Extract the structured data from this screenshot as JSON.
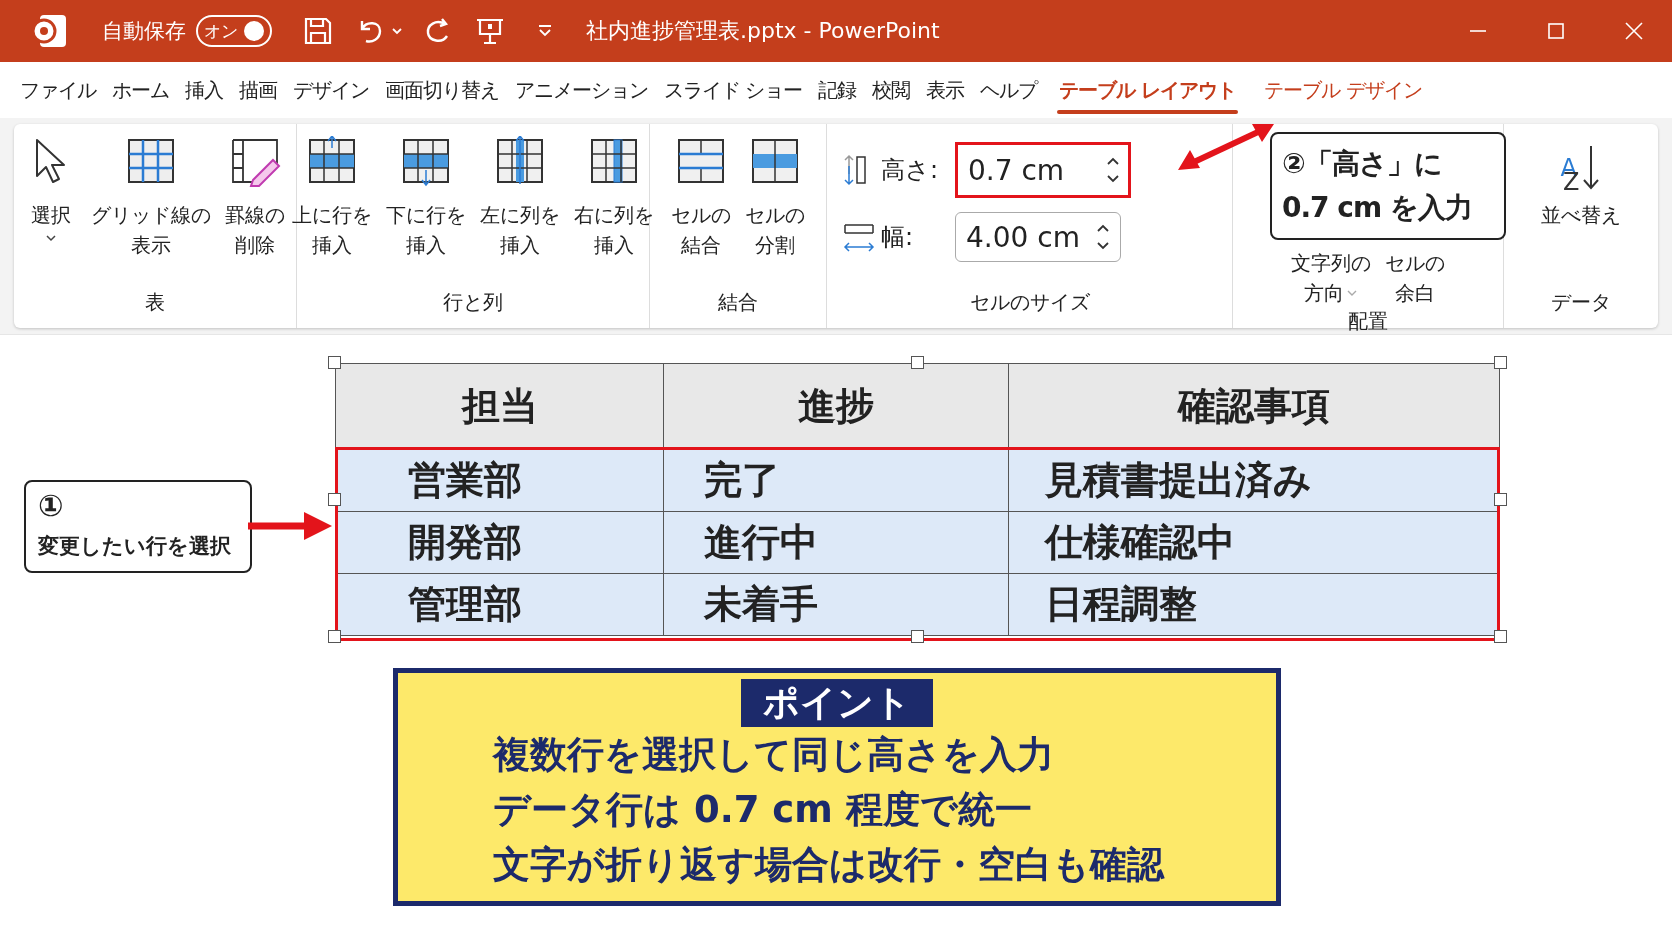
{
  "window": {
    "title": "社内進捗管理表.pptx - PowerPoint"
  },
  "quick_access": {
    "autosave_label": "自動保存",
    "autosave": {
      "label": "オン",
      "on": true
    }
  },
  "tabs": [
    {
      "label": "ファイル",
      "selected": false,
      "contextual": false
    },
    {
      "label": "ホーム",
      "selected": false,
      "contextual": false
    },
    {
      "label": "挿入",
      "selected": false,
      "contextual": false
    },
    {
      "label": "描画",
      "selected": false,
      "contextual": false
    },
    {
      "label": "デザイン",
      "selected": false,
      "contextual": false
    },
    {
      "label": "画面切り替え",
      "selected": false,
      "contextual": false
    },
    {
      "label": "アニメーション",
      "selected": false,
      "contextual": false
    },
    {
      "label": "スライド ショー",
      "selected": false,
      "contextual": false
    },
    {
      "label": "記録",
      "selected": false,
      "contextual": false
    },
    {
      "label": "校閲",
      "selected": false,
      "contextual": false
    },
    {
      "label": "表示",
      "selected": false,
      "contextual": false
    },
    {
      "label": "ヘルプ",
      "selected": false,
      "contextual": false
    },
    {
      "label": "テーブル レイアウト",
      "selected": true,
      "contextual": true
    },
    {
      "label": "テーブル デザイン",
      "selected": false,
      "contextual": true
    }
  ],
  "ribbon": {
    "groups": [
      {
        "label": "表",
        "kind": "buttons",
        "buttons": [
          {
            "kind": "select",
            "lines": [
              "選択"
            ],
            "dropdown": true
          },
          {
            "kind": "gridlines",
            "lines": [
              "グリッド線の",
              "表示"
            ],
            "dropdown": false
          },
          {
            "kind": "erase",
            "lines": [
              "罫線の",
              "削除"
            ],
            "dropdown": false
          }
        ]
      },
      {
        "label": "行と列",
        "kind": "buttons",
        "buttons": [
          {
            "kind": "insert_above",
            "lines": [
              "上に行を",
              "挿入"
            ],
            "dropdown": false
          },
          {
            "kind": "insert_below",
            "lines": [
              "下に行を",
              "挿入"
            ],
            "dropdown": false
          },
          {
            "kind": "insert_left",
            "lines": [
              "左に列を",
              "挿入"
            ],
            "dropdown": false
          },
          {
            "kind": "insert_right",
            "lines": [
              "右に列を",
              "挿入"
            ],
            "dropdown": false
          }
        ]
      },
      {
        "label": "結合",
        "kind": "buttons",
        "buttons": [
          {
            "kind": "merge",
            "lines": [
              "セルの",
              "結合"
            ],
            "dropdown": false
          },
          {
            "kind": "split",
            "lines": [
              "セルの",
              "分割"
            ],
            "dropdown": false
          }
        ]
      },
      {
        "label": "セルのサイズ",
        "kind": "fields",
        "fields": [
          {
            "kind": "height",
            "label": "高さ:",
            "value": "0.7 cm",
            "highlighted": true
          },
          {
            "kind": "width",
            "label": "幅:",
            "value": "4.00 cm",
            "highlighted": false
          }
        ]
      },
      {
        "label": "配置",
        "kind": "buttons",
        "buttons": [
          {
            "kind": "text_direction",
            "lines": [
              "文字列の",
              "方向"
            ],
            "dropdown": true
          },
          {
            "kind": "cell_margins",
            "lines": [
              "セルの",
              "余白"
            ],
            "dropdown": false
          }
        ]
      },
      {
        "label": "データ",
        "kind": "buttons",
        "buttons": [
          {
            "kind": "sort",
            "glyphs": [
              "A",
              "Z"
            ],
            "lines": [
              "並べ替え"
            ],
            "dropdown": false
          }
        ]
      }
    ]
  },
  "table": {
    "columns": [
      "担当",
      "進捗",
      "確認事項"
    ],
    "rows": [
      {
        "cells": [
          "営業部",
          "完了",
          "見積書提出済み"
        ],
        "selected": true
      },
      {
        "cells": [
          "開発部",
          "進行中",
          "仕様確認中"
        ],
        "selected": true
      },
      {
        "cells": [
          "管理部",
          "未着手",
          "日程調整"
        ],
        "selected": true
      }
    ]
  },
  "callouts": [
    {
      "number": "①",
      "lines": [
        "変更したい行を選択"
      ]
    },
    {
      "number": "②",
      "lines": [
        "「高さ」に",
        "0.7 cm を入力"
      ]
    }
  ],
  "point_box": {
    "title": "ポイント",
    "lines": [
      "複数行を選択して同じ高さを入力",
      "データ行は 0.7 cm 程度で統一",
      "文字が折り返す場合は改行・空白も確認"
    ]
  }
}
